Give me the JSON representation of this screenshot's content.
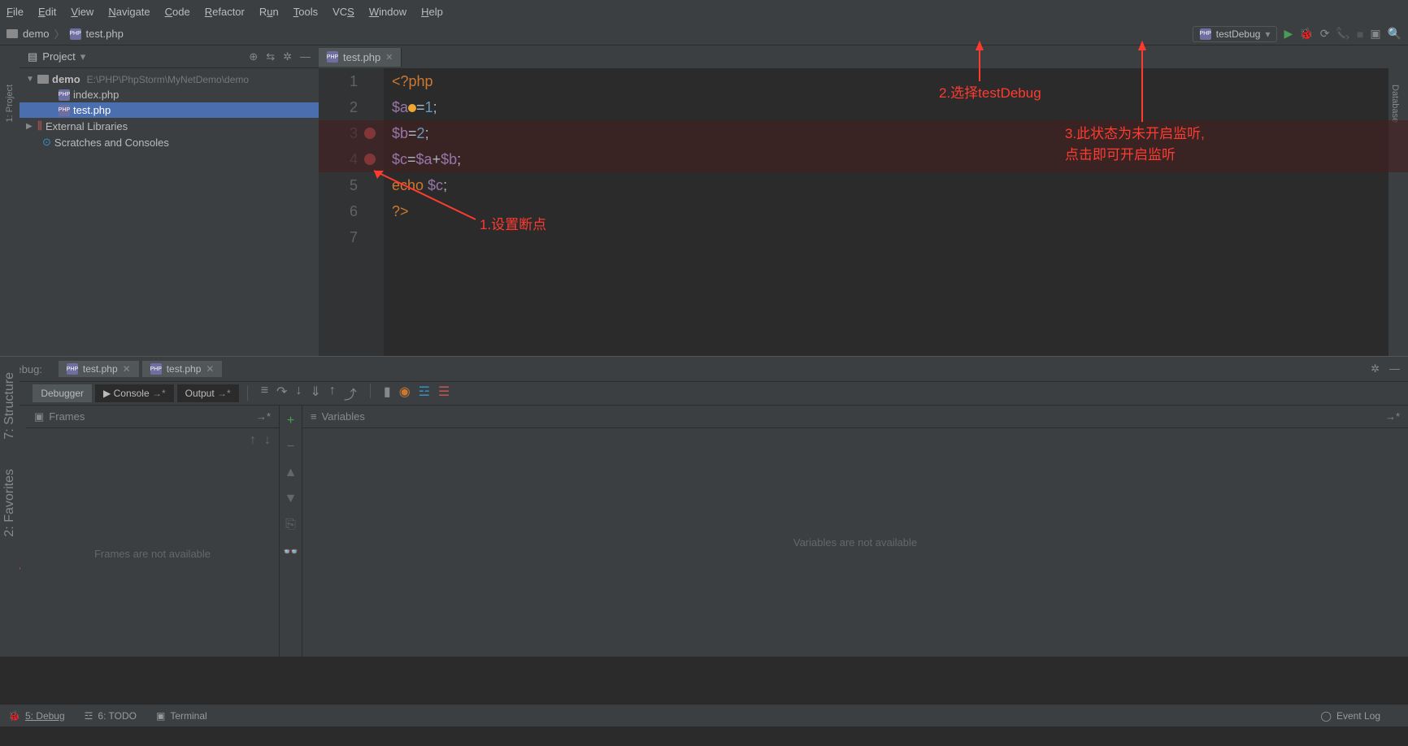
{
  "menu": [
    "File",
    "Edit",
    "View",
    "Navigate",
    "Code",
    "Refactor",
    "Run",
    "Tools",
    "VCS",
    "Window",
    "Help"
  ],
  "breadcrumb": {
    "project": "demo",
    "file": "test.php"
  },
  "runConfig": {
    "selected": "testDebug"
  },
  "projectPanel": {
    "title": "Project",
    "root": {
      "name": "demo",
      "path": "E:\\PHP\\PhpStorm\\MyNetDemo\\demo"
    },
    "files": [
      "index.php",
      "test.php"
    ],
    "extLibs": "External Libraries",
    "scratches": "Scratches and Consoles"
  },
  "editor": {
    "tab": "test.php",
    "lines": [
      {
        "n": 1,
        "html": "<span class='kw-tag'>&lt;?php</span>"
      },
      {
        "n": 2,
        "html": "<span class='var'>$a</span><span class='bulb'></span><span class='op'>=</span><span class='num'>1</span><span class='op'>;</span>"
      },
      {
        "n": 3,
        "bp": true,
        "html": "<span class='var'>$b</span><span class='op'>=</span><span class='num'>2</span><span class='op'>;</span>"
      },
      {
        "n": 4,
        "bp": true,
        "html": "<span class='var'>$c</span><span class='op'>=</span><span class='var'>$a</span><span class='op'>+</span><span class='var'>$b</span><span class='op'>;</span>"
      },
      {
        "n": 5,
        "html": "<span class='kw'>echo </span><span class='var'>$c</span><span class='op'>;</span>"
      },
      {
        "n": 6,
        "html": "<span class='kw-tag'>?&gt;</span>"
      },
      {
        "n": 7,
        "html": ""
      }
    ]
  },
  "annotations": {
    "a1": "1.设置断点",
    "a2": "2.选择testDebug",
    "a3_line1": "3.此状态为未开启监听,",
    "a3_line2": "点击即可开启监听"
  },
  "debug": {
    "label": "Debug:",
    "tabs": [
      "test.php",
      "test.php"
    ],
    "subtabs": {
      "debugger": "Debugger",
      "console": "Console",
      "output": "Output"
    },
    "frames": {
      "title": "Frames",
      "empty": "Frames are not available"
    },
    "variables": {
      "title": "Variables",
      "empty": "Variables are not available"
    }
  },
  "statusBar": {
    "debug": "5: Debug",
    "todo": "6: TODO",
    "terminal": "Terminal",
    "eventLog": "Event Log"
  },
  "leftTabs": {
    "project": "1: Project",
    "structure": "7: Structure",
    "favorites": "2: Favorites"
  },
  "rightTabs": {
    "database": "Database"
  }
}
